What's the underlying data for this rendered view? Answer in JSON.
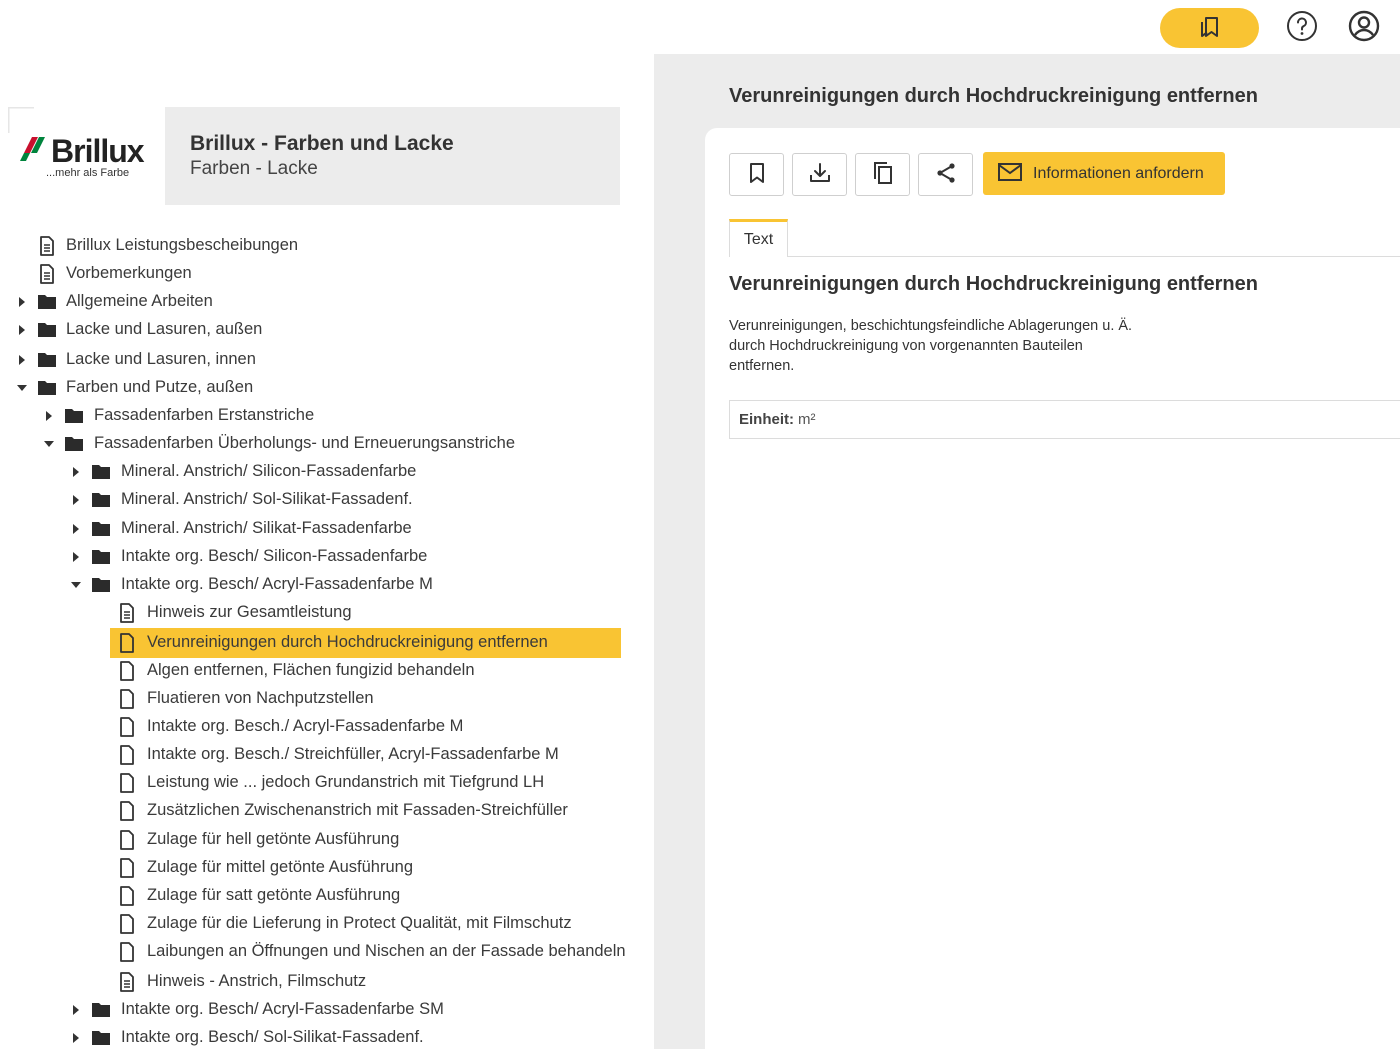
{
  "header": {
    "bookmarks_icon": "bookmarks-icon",
    "help_icon": "help-circle-icon",
    "account_icon": "user-circle-icon",
    "accent": "#f9c433"
  },
  "brand": {
    "logo_text": "Brillux",
    "logo_tagline": "...mehr als Farbe",
    "title": "Brillux - Farben und Lacke",
    "subtitle": "Farben - Lacke"
  },
  "tree": [
    {
      "label": "Brillux Leistungsbescheibungen",
      "type": "doc-text"
    },
    {
      "label": "Vorbemerkungen",
      "type": "doc-text"
    },
    {
      "label": "Allgemeine Arbeiten",
      "type": "folder",
      "state": "collapsed"
    },
    {
      "label": "Lacke und Lasuren, außen",
      "type": "folder",
      "state": "collapsed"
    },
    {
      "label": "Lacke und Lasuren, innen",
      "type": "folder",
      "state": "collapsed"
    },
    {
      "label": "Farben und Putze, außen",
      "type": "folder",
      "state": "expanded"
    },
    {
      "label": "Fassadenfarben Erstanstriche",
      "type": "folder",
      "state": "collapsed"
    },
    {
      "label": "Fassadenfarben Überholungs- und Erneuerungsanstriche",
      "type": "folder",
      "state": "expanded"
    },
    {
      "label": "Mineral. Anstrich/ Silicon-Fassadenfarbe",
      "type": "folder",
      "state": "collapsed"
    },
    {
      "label": "Mineral. Anstrich/ Sol-Silikat-Fassadenf.",
      "type": "folder",
      "state": "collapsed"
    },
    {
      "label": "Mineral. Anstrich/ Silikat-Fassadenfarbe",
      "type": "folder",
      "state": "collapsed"
    },
    {
      "label": "Intakte org. Besch/ Silicon-Fassadenfarbe",
      "type": "folder",
      "state": "collapsed"
    },
    {
      "label": "Intakte org. Besch/ Acryl-Fassadenfarbe M",
      "type": "folder",
      "state": "expanded"
    },
    {
      "label": "Hinweis zur Gesamtleistung",
      "type": "doc-text"
    },
    {
      "label": "Verunreinigungen durch Hochdruckreinigung entfernen",
      "type": "doc",
      "selected": true
    },
    {
      "label": "Algen entfernen, Flächen fungizid behandeln",
      "type": "doc"
    },
    {
      "label": "Fluatieren von Nachputzstellen",
      "type": "doc"
    },
    {
      "label": "Intakte org. Besch./ Acryl-Fassadenfarbe M",
      "type": "doc"
    },
    {
      "label": "Intakte org. Besch./ Streichfüller, Acryl-Fassadenfarbe M",
      "type": "doc"
    },
    {
      "label": "Leistung wie ... jedoch Grundanstrich mit Tiefgrund LH",
      "type": "doc"
    },
    {
      "label": "Zusätzlichen Zwischenanstrich mit Fassaden-Streichfüller",
      "type": "doc"
    },
    {
      "label": "Zulage für hell getönte Ausführung",
      "type": "doc"
    },
    {
      "label": "Zulage für mittel getönte Ausführung",
      "type": "doc"
    },
    {
      "label": "Zulage für satt getönte Ausführung",
      "type": "doc"
    },
    {
      "label": "Zulage für die Lieferung in Protect Qualität, mit Filmschutz",
      "type": "doc"
    },
    {
      "label": "Laibungen an Öffnungen und Nischen an der Fassade behandeln",
      "type": "doc"
    },
    {
      "label": "Hinweis - Anstrich, Filmschutz",
      "type": "doc-text"
    },
    {
      "label": "Intakte org. Besch/ Acryl-Fassadenfarbe SM",
      "type": "folder",
      "state": "collapsed"
    },
    {
      "label": "Intakte org. Besch/ Sol-Silikat-Fassadenf.",
      "type": "folder",
      "state": "collapsed"
    }
  ],
  "detail": {
    "header_title": "Verunreinigungen durch Hochdruckreinigung entfernen",
    "toolbar": {
      "bookmark_icon": "bookmark-icon",
      "download_icon": "download-icon",
      "copy_icon": "copy-icon",
      "share_icon": "share-icon",
      "request_label": "Informationen anfordern",
      "request_icon": "mail-icon"
    },
    "tab_label": "Text",
    "title": "Verunreinigungen durch Hochdruckreinigung entfernen",
    "description_lines": [
      "Verunreinigungen, beschichtungsfeindliche Ablagerungen u. Ä.",
      "durch Hochdruckreinigung von vorgenannten Bauteilen",
      "entfernen."
    ],
    "unit_label": "Einheit:",
    "unit_value": "m²"
  }
}
